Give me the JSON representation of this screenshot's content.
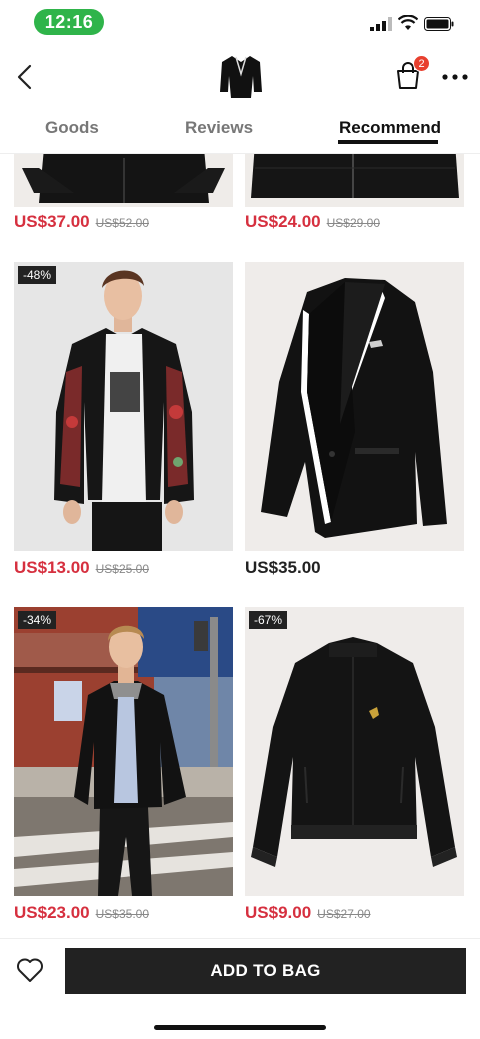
{
  "status_bar": {
    "time": "12:16"
  },
  "header": {
    "cart_count": "2"
  },
  "tabs": [
    {
      "label": "Goods",
      "active": false
    },
    {
      "label": "Reviews",
      "active": false
    },
    {
      "label": "Recommend",
      "active": true
    }
  ],
  "products": [
    {
      "price": "US$37.00",
      "original_price": "US$52.00",
      "discount": ""
    },
    {
      "price": "US$24.00",
      "original_price": "US$29.00",
      "discount": ""
    },
    {
      "price": "US$13.00",
      "original_price": "US$25.00",
      "discount": "-48%"
    },
    {
      "price": "US$35.00",
      "original_price": "",
      "discount": ""
    },
    {
      "price": "US$23.00",
      "original_price": "US$35.00",
      "discount": "-34%"
    },
    {
      "price": "US$9.00",
      "original_price": "US$27.00",
      "discount": "-67%"
    }
  ],
  "bottom_bar": {
    "add_to_bag_label": "ADD TO BAG"
  },
  "colors": {
    "accent_red": "#d6303f",
    "status_green": "#2fb44a",
    "badge_red": "#e8402f",
    "button_dark": "#222222"
  }
}
